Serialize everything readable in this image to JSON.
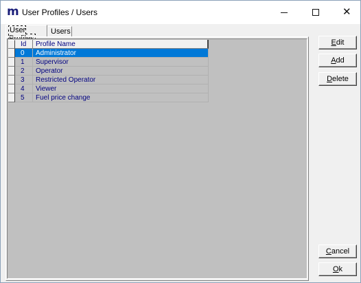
{
  "window": {
    "title": "User Profiles / Users",
    "app_icon": "m",
    "controls": {
      "minimize_icon": "minimize-icon",
      "maximize_icon": "maximize-icon",
      "close_icon": "close-icon",
      "close_glyph": "✕"
    }
  },
  "tabs": [
    {
      "label": "User Profiles",
      "active": true
    },
    {
      "label": "Users",
      "active": false
    }
  ],
  "grid": {
    "columns": [
      "Id",
      "Profile Name"
    ],
    "rows": [
      {
        "id": "0",
        "name": "Administrator",
        "selected": true
      },
      {
        "id": "1",
        "name": "Supervisor",
        "selected": false
      },
      {
        "id": "2",
        "name": "Operator",
        "selected": false
      },
      {
        "id": "3",
        "name": "Restricted Operator",
        "selected": false
      },
      {
        "id": "4",
        "name": "Viewer",
        "selected": false
      },
      {
        "id": "5",
        "name": "Fuel price change",
        "selected": false
      }
    ]
  },
  "buttons": {
    "edit": "Edit",
    "add": "Add",
    "delete": "Delete",
    "cancel": "Cancel",
    "ok": "Ok"
  },
  "colors": {
    "selection": "#0078d7",
    "grid_background": "#c0c0c0",
    "grid_text": "#000080",
    "app_icon": "#1b1f7a"
  }
}
